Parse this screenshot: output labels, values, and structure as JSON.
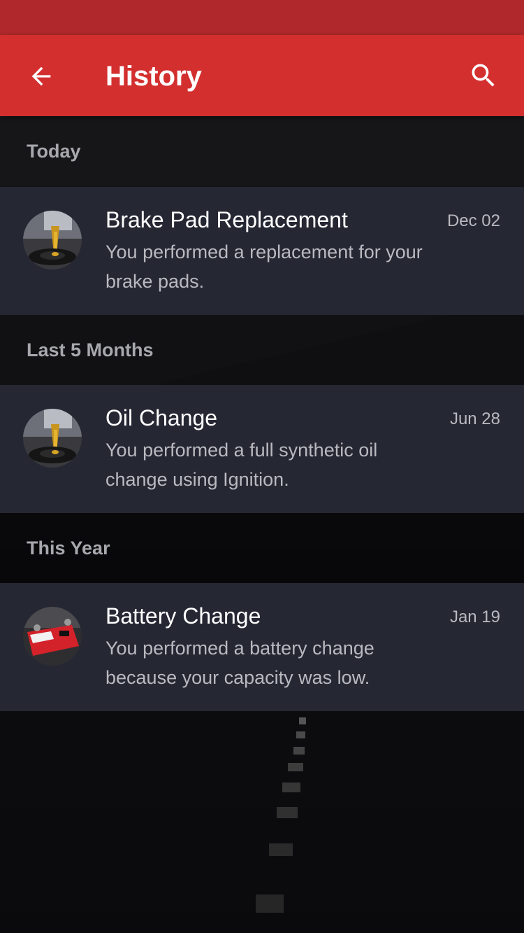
{
  "app_bar": {
    "title": "History",
    "back_icon": "arrow-back-icon",
    "search_icon": "search-icon",
    "color": "#d32f2f",
    "status_bar_color": "#b0282b"
  },
  "sections": [
    {
      "label": "Today",
      "items": [
        {
          "title": "Brake Pad Replacement",
          "description": "You performed a replacement for your brake pads.",
          "date": "Dec 02",
          "thumbnail": "oil-pour-icon"
        }
      ]
    },
    {
      "label": "Last 5 Months",
      "items": [
        {
          "title": "Oil Change",
          "description": "You performed a full synthetic oil change using Ignition.",
          "date": "Jun 28",
          "thumbnail": "oil-pour-icon"
        }
      ]
    },
    {
      "label": "This Year",
      "items": [
        {
          "title": "Battery Change",
          "description": "You performed a battery change because your capacity was low.",
          "date": "Jan 19",
          "thumbnail": "car-battery-icon"
        }
      ]
    }
  ]
}
